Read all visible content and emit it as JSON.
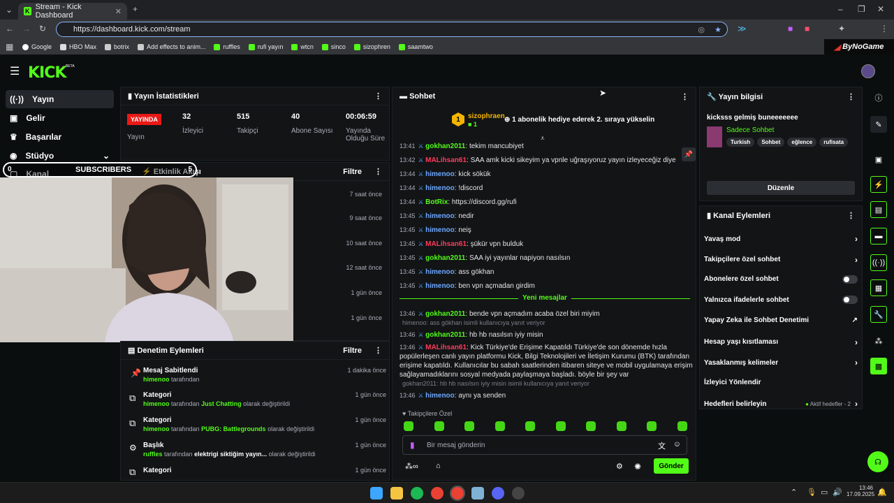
{
  "browser": {
    "tab_title": "Stream - Kick Dashboard",
    "url": "https://dashboard.kick.com/stream",
    "bookmarks": [
      "Google",
      "HBO Max",
      "botrix",
      "Add effects to anim...",
      "ruffles",
      "rufi yayın",
      "wtcn",
      "sinco",
      "sizophren",
      "saamtwo"
    ],
    "overlay_brand": "ByNoGame"
  },
  "app": {
    "logo": "KICK",
    "logo_badge": "BETA"
  },
  "sidebar": {
    "items": [
      {
        "label": "Yayın",
        "icon": "broadcast-icon"
      },
      {
        "label": "Gelir",
        "icon": "money-icon"
      },
      {
        "label": "Başarılar",
        "icon": "trophy-icon"
      },
      {
        "label": "Stüdyo",
        "icon": "studio-icon"
      },
      {
        "label": "Kanal",
        "icon": "channel-icon"
      }
    ]
  },
  "stats": {
    "title": "Yayın İstatistikleri",
    "live_badge": "YAYINDA",
    "live_label": "Yayın",
    "items": [
      {
        "value": "32",
        "label": "İzleyici"
      },
      {
        "value": "515",
        "label": "Takipçi"
      },
      {
        "value": "40",
        "label": "Abone Sayısı"
      },
      {
        "value": "00:06:59",
        "label": "Yayında Olduğu Süre"
      }
    ]
  },
  "activity": {
    "subscribers_left": "0",
    "subscribers_label": "SUBSCRIBERS",
    "subscribers_right": "5",
    "title": "Etkinlik Akışı",
    "filter": "Filtre",
    "times": [
      "7 saat önce",
      "9 saat önce",
      "10 saat önce",
      "12 saat önce",
      "1 gün önce",
      "1 gün önce"
    ]
  },
  "mod_actions": {
    "title": "Denetim Eylemleri",
    "filter": "Filtre",
    "items": [
      {
        "title": "Mesaj Sabitlendi",
        "user": "himenoo",
        "text": "tarafından",
        "time": "1 dakika önce"
      },
      {
        "title": "Kategori",
        "user": "himenoo",
        "text": "tarafından",
        "category": "Just Chatting",
        "suffix": "olarak değiştirildi",
        "time": "1 gün önce"
      },
      {
        "title": "Kategori",
        "user": "himenoo",
        "text": "tarafından",
        "category": "PUBG: Battlegrounds",
        "suffix": "olarak değiştirildi",
        "time": "1 gün önce"
      },
      {
        "title": "Başlık",
        "user": "ruffles",
        "text": "tarafından",
        "category": "elektrigi siktiğim yayın...",
        "suffix": "olarak değiştirildi",
        "time": "1 gün önce"
      },
      {
        "title": "Kategori",
        "user": "",
        "text": "",
        "time": "1 gün önce"
      }
    ]
  },
  "chat": {
    "title": "Sohbet",
    "gift_user": "sizophraen",
    "gift_count": "1",
    "gift_rank": "1",
    "gift_text": "1 abonelik hediye ederek 2. sıraya yükselin",
    "messages": [
      {
        "time": "13:41",
        "user": "gokhan2011",
        "text": "tekim mancubiyet",
        "color": "green"
      },
      {
        "time": "13:42",
        "user": "MALihsan61",
        "text": "SAA amk kicki sikeyim ya vpnle uğraşıyoruz yayın izleyeceğiz diye",
        "color": "red"
      },
      {
        "time": "13:44",
        "user": "himenoo",
        "text": "kick sökük",
        "color": "blue"
      },
      {
        "time": "13:44",
        "user": "himenoo",
        "text": "!discord",
        "color": "blue"
      },
      {
        "time": "13:44",
        "user": "BotRix",
        "text": "https://discord.gg/rufi",
        "color": "green"
      },
      {
        "time": "13:45",
        "user": "himenoo",
        "text": "nedir",
        "color": "blue"
      },
      {
        "time": "13:45",
        "user": "himenoo",
        "text": "neiş",
        "color": "blue"
      },
      {
        "time": "13:45",
        "user": "MALihsan61",
        "text": "şükür vpn bulduk",
        "color": "red"
      },
      {
        "time": "13:45",
        "user": "gokhan2011",
        "text": "SAA iyi yayınlar napiyon nasılsın",
        "color": "green"
      },
      {
        "time": "13:45",
        "user": "himenoo",
        "text": "ass gökhan",
        "color": "blue"
      },
      {
        "time": "13:45",
        "user": "himenoo",
        "text": "ben vpn açmadan girdim",
        "color": "blue"
      }
    ],
    "new_messages": "Yeni mesajlar",
    "messages2": [
      {
        "time": "13:46",
        "user": "gokhan2011",
        "text": "bende vpn açmadım acaba özel biri miyim",
        "color": "green"
      },
      {
        "reply": "himenoo: ass gökhan isimli kullanıcıya yanıt veriyor"
      },
      {
        "time": "13:46",
        "user": "gokhan2011",
        "text": "hb hb nasılsın iyiy misin",
        "color": "green"
      },
      {
        "time": "13:46",
        "user": "MALihsan61",
        "text": "Kick Türkiye'de Erişime Kapatıldı Türkiye'de son dönemde hızla popülerleşen canlı yayın platformu Kick, Bilgi Teknolojileri ve İletişim Kurumu (BTK) tarafından erişime kapatıldı. Kullanıcılar bu sabah saatlerinden itibaren siteye ve mobil uygulamaya erişim sağlayamadıklarını sosyal medyada paylaşmaya başladı. böyle bir şey var",
        "color": "red"
      },
      {
        "reply": "gokhan2011: hb hb nasılsın iyiy misin isimli kullanıcıya yanıt veriyor"
      },
      {
        "time": "13:46",
        "user": "himenoo",
        "text": "aynı ya senden",
        "color": "blue"
      }
    ],
    "followers_only": "Takipçilere Özel",
    "placeholder": "Bir mesaj gönderin",
    "send": "Gönder"
  },
  "stream_info": {
    "title": "Yayın bilgisi",
    "stream_title": "kicksss gelmiş buneeeeeee",
    "category": "Sadece Sohbet",
    "tags": [
      "Turkish",
      "Sohbet",
      "eğlence",
      "rufisata"
    ],
    "edit": "Düzenle"
  },
  "channel_actions": {
    "title": "Kanal Eylemleri",
    "items": [
      {
        "label": "Yavaş mod",
        "control": "chevron"
      },
      {
        "label": "Takipçilere özel sohbet",
        "control": "chevron"
      },
      {
        "label": "Abonelere özel sohbet",
        "control": "toggle"
      },
      {
        "label": "Yalnızca ifadelerle sohbet",
        "control": "toggle"
      },
      {
        "label": "Yapay Zeka ile Sohbet Denetimi",
        "control": "external"
      },
      {
        "label": "Hesap yaşı kısıtlaması",
        "control": "chevron"
      },
      {
        "label": "Yasaklanmış kelimeler",
        "control": "chevron"
      },
      {
        "label": "İzleyici Yönlendir",
        "control": "none"
      },
      {
        "label": "Hedefleri belirleyin",
        "control": "chevron"
      }
    ],
    "goals_status": "Aktif hedefler - 2"
  },
  "taskbar": {
    "time": "13:46",
    "date": "17.09.2025"
  }
}
